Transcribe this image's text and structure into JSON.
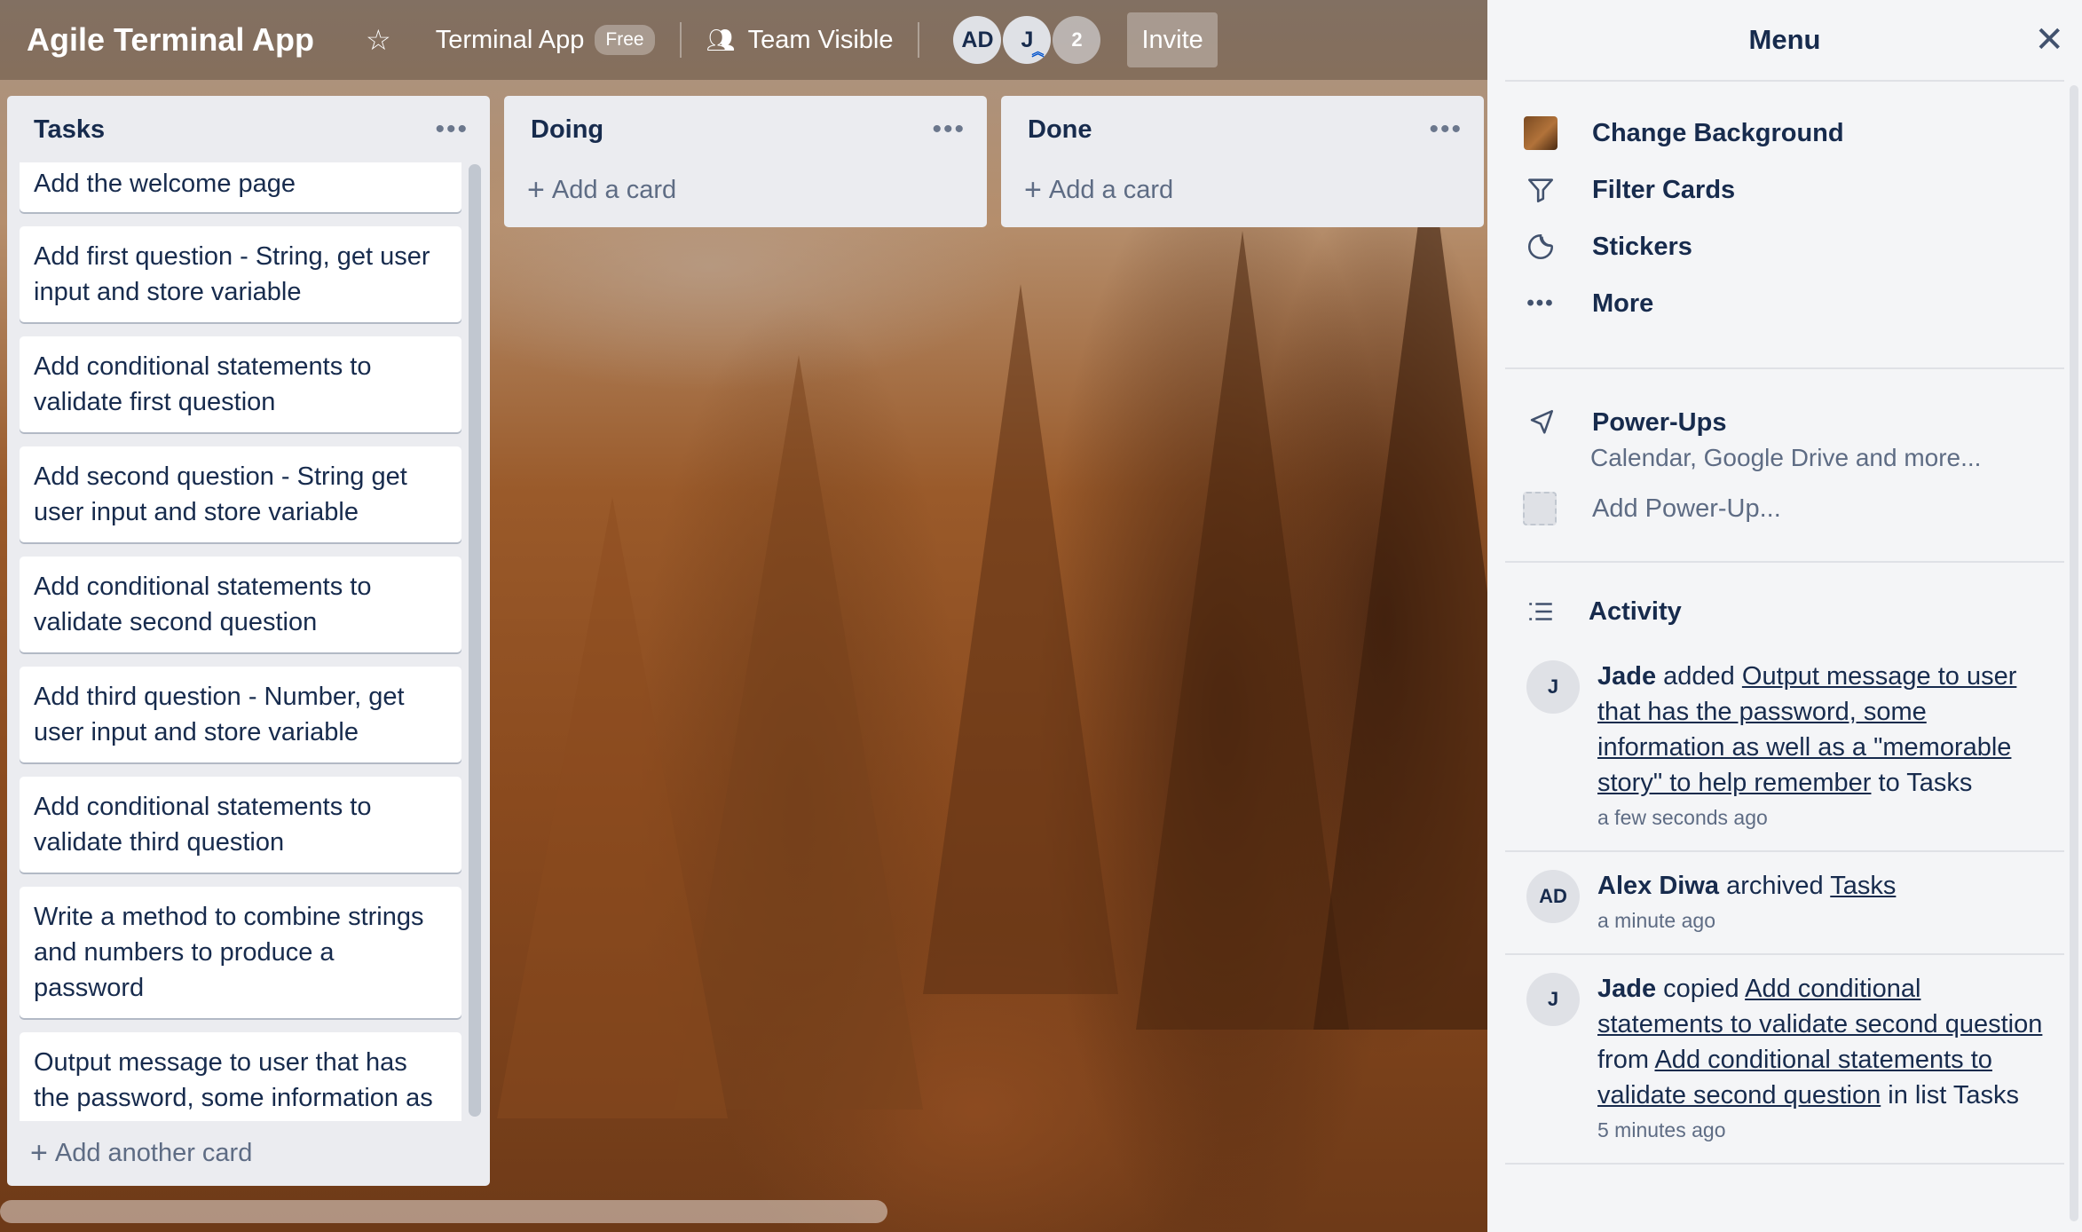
{
  "header": {
    "board_title": "Agile Terminal App",
    "workspace": "Terminal App",
    "plan_badge": "Free",
    "visibility": "Team Visible",
    "members": [
      "AD",
      "J"
    ],
    "extra_members": "2",
    "invite_label": "Invite"
  },
  "lists": [
    {
      "title": "Tasks",
      "cards": [
        "Add the welcome page",
        "Add first question - String, get user input and store variable",
        "Add conditional statements to validate first question",
        "Add second question - String get user input and store variable",
        "Add conditional statements to validate second question",
        "Add third question - Number, get user input and store variable",
        "Add conditional statements to validate third question",
        "Write a method to combine strings and numbers to produce a password",
        "Output message to user that has the password, some information as well as a \"memorable story\" to help remember"
      ],
      "add_label": "Add another card"
    },
    {
      "title": "Doing",
      "cards": [],
      "add_label": "Add a card"
    },
    {
      "title": "Done",
      "cards": [],
      "add_label": "Add a card"
    }
  ],
  "menu": {
    "title": "Menu",
    "items": [
      {
        "label": "Change Background",
        "icon": "background-thumbnail"
      },
      {
        "label": "Filter Cards",
        "icon": "filter-icon"
      },
      {
        "label": "Stickers",
        "icon": "sticker-icon"
      },
      {
        "label": "More",
        "icon": "more-icon"
      }
    ],
    "powerups": {
      "title": "Power-Ups",
      "subtitle": "Calendar, Google Drive and more...",
      "add_label": "Add Power-Up..."
    },
    "activity": {
      "title": "Activity",
      "entries": [
        {
          "avatar": "J",
          "user": "Jade",
          "action": "added",
          "target": "Output message to user that has the password, some information as well as a \"memorable story\" to help remember",
          "suffix": "to Tasks",
          "time": "a few seconds ago"
        },
        {
          "avatar": "AD",
          "user": "Alex Diwa",
          "action": "archived",
          "target": "Tasks",
          "suffix": "",
          "time": "a minute ago"
        },
        {
          "avatar": "J",
          "user": "Jade",
          "action": "copied",
          "target": "Add conditional statements to validate second question",
          "mid": "from",
          "target2": "Add conditional statements to validate second question",
          "suffix": "in list Tasks",
          "time": "5 minutes ago"
        }
      ]
    }
  }
}
